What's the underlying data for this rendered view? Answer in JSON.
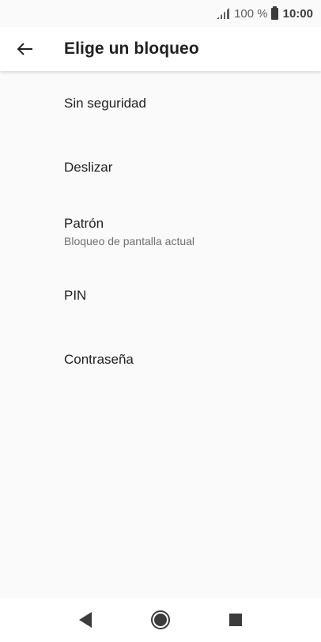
{
  "status_bar": {
    "battery_percent": "100 %",
    "time": "10:00",
    "icons": [
      "signal-icon",
      "battery-icon"
    ]
  },
  "app_bar": {
    "back_icon": "arrow-back-icon",
    "title": "Elige un bloqueo"
  },
  "lock_options": [
    {
      "label": "Sin seguridad",
      "subtitle": ""
    },
    {
      "label": "Deslizar",
      "subtitle": ""
    },
    {
      "label": "Patrón",
      "subtitle": "Bloqueo de pantalla actual"
    },
    {
      "label": "PIN",
      "subtitle": ""
    },
    {
      "label": "Contraseña",
      "subtitle": ""
    }
  ],
  "nav_bar": {
    "icons": [
      "back-triangle-icon",
      "home-circle-icon",
      "recents-square-icon"
    ]
  },
  "colors": {
    "background": "#fafafa",
    "app_bar": "#ffffff",
    "primary_text": "#212121",
    "secondary_text": "#6f6f6f",
    "nav_icon": "#3c3c3c"
  }
}
